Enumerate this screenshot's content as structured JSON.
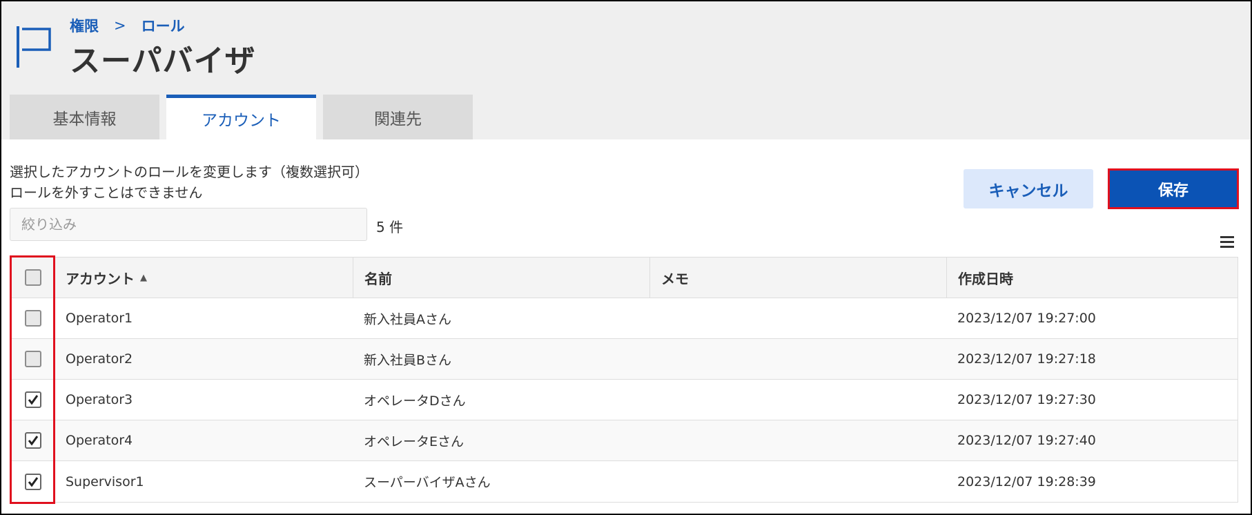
{
  "breadcrumb": {
    "item1": "権限",
    "separator": ">",
    "item2": "ロール"
  },
  "page": {
    "title": "スーパバイザ"
  },
  "tabs": [
    {
      "label": "基本情報",
      "active": false
    },
    {
      "label": "アカウント",
      "active": true
    },
    {
      "label": "関連先",
      "active": false
    }
  ],
  "description": {
    "line1": "選択したアカウントのロールを変更します（複数選択可）",
    "line2": "ロールを外すことはできません"
  },
  "buttons": {
    "cancel": "キャンセル",
    "save": "保存"
  },
  "filter": {
    "placeholder": "絞り込み",
    "value": ""
  },
  "count": "5 件",
  "table": {
    "headers": {
      "account": "アカウント",
      "sort": "▲",
      "name": "名前",
      "memo": "メモ",
      "created": "作成日時"
    },
    "rows": [
      {
        "account": "Operator1",
        "name": "新入社員Aさん",
        "memo": "",
        "created": "2023/12/07 19:27:00",
        "checked": false
      },
      {
        "account": "Operator2",
        "name": "新入社員Bさん",
        "memo": "",
        "created": "2023/12/07 19:27:18",
        "checked": false
      },
      {
        "account": "Operator3",
        "name": "オペレータDさん",
        "memo": "",
        "created": "2023/12/07 19:27:30",
        "checked": true
      },
      {
        "account": "Operator4",
        "name": "オペレータEさん",
        "memo": "",
        "created": "2023/12/07 19:27:40",
        "checked": true
      },
      {
        "account": "Supervisor1",
        "name": "スーパーバイザAさん",
        "memo": "",
        "created": "2023/12/07 19:28:39",
        "checked": true
      }
    ]
  },
  "colors": {
    "accent": "#1a5eb8",
    "save_bg": "#0b53b5",
    "highlight": "#e0101e"
  },
  "icons": {
    "page": "flag-icon",
    "menu": "menu-icon",
    "check": "check-icon"
  }
}
